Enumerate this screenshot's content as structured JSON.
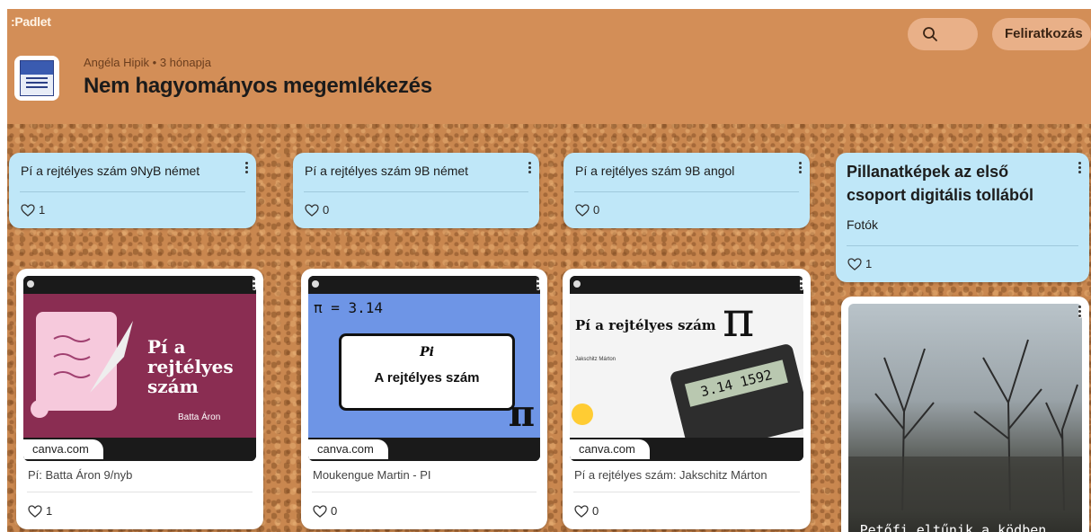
{
  "app": {
    "logo": ":Padlet"
  },
  "header": {
    "author": "Angéla Hipik",
    "separator": "•",
    "time": "3 hónapja",
    "title": "Nem hagyományos megemlékezés",
    "subscribe_label": "Feliratkozás"
  },
  "colors": {
    "header_bg": "#d38e57",
    "card_blue": "#bfe7f8",
    "cork": "#c9874f",
    "slide1_bg": "#8a2d52",
    "slide2_bg": "#6e95e6"
  },
  "columns": [
    {
      "header_card": {
        "title": "Pí a rejtélyes szám 9NyB német",
        "likes": "1"
      },
      "post": {
        "slide_title": "Pí a rejtélyes szám",
        "slide_author": "Batta Áron",
        "domain": "canva.com",
        "caption": "Pí: Batta Áron 9/nyb",
        "likes": "1"
      }
    },
    {
      "header_card": {
        "title": "Pí a rejtélyes szám 9B német",
        "likes": "0"
      },
      "post": {
        "slide_pi": "π = 3.14",
        "slide_title_1": "Pi",
        "slide_title_2": "A rejtélyes szám",
        "domain": "canva.com",
        "caption": "Moukengue Martin - PI",
        "likes": "0"
      }
    },
    {
      "header_card": {
        "title": "Pí a rejtélyes szám 9B angol",
        "likes": "0"
      },
      "post": {
        "slide_title": "Pí a rejtélyes szám",
        "slide_author": "Jakschitz Márton",
        "calc_display": "3.14 1592",
        "domain": "canva.com",
        "caption": "Pí a rejtélyes szám: Jakschitz Márton",
        "likes": "0"
      }
    },
    {
      "header_card": {
        "title": "Pillanatképek az első csoport digitális tollából",
        "subtitle": "Fotók",
        "likes": "1"
      },
      "post": {
        "image_text": "Petőfi eltűnik a ködben..."
      }
    }
  ],
  "icons": [
    "search-icon",
    "heart-icon",
    "kebab-icon",
    "pi-icon"
  ]
}
